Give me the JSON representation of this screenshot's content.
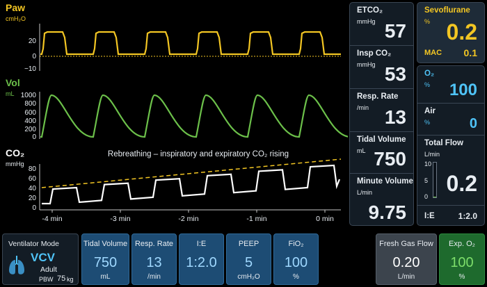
{
  "waveforms": {
    "paw": {
      "label": "Paw",
      "unit": "cmH₂O",
      "ticks": [
        "20",
        "0",
        "−10"
      ],
      "color": "#f3c623"
    },
    "vol": {
      "label": "Vol",
      "unit": "mL",
      "ticks": [
        "1000",
        "800",
        "600",
        "400",
        "200",
        "0"
      ],
      "color": "#6cc04a"
    },
    "co2": {
      "label": "CO₂",
      "unit": "mmHg",
      "ticks": [
        "80",
        "60",
        "40",
        "20",
        "0"
      ],
      "color": "#ffffff",
      "annotation": "Rebreathing – inspiratory and expiratory CO₂ rising"
    },
    "time_axis": [
      "-4 min",
      "-3 min",
      "-2 min",
      "-1 min",
      "0 min"
    ]
  },
  "measurements": {
    "etco2": {
      "label": "ETCO₂",
      "unit": "mmHg",
      "value": "57"
    },
    "insp_co2": {
      "label": "Insp CO₂",
      "unit": "mmHg",
      "value": "53"
    },
    "resp_rate": {
      "label": "Resp. Rate",
      "unit": "/min",
      "value": "13"
    },
    "tidal_volume": {
      "label": "Tidal Volume",
      "unit": "mL",
      "value": "750"
    },
    "minute_volume": {
      "label": "Minute Volume",
      "unit": "L/min",
      "value": "9.75"
    }
  },
  "gas": {
    "agent": {
      "label": "Sevoflurane",
      "unit": "%",
      "value": "0.2",
      "mac_label": "MAC",
      "mac_value": "0.1"
    },
    "o2": {
      "label": "O₂",
      "unit": "%",
      "value": "100"
    },
    "air": {
      "label": "Air",
      "unit": "%",
      "value": "0"
    },
    "total_flow": {
      "label": "Total Flow",
      "unit": "L/min",
      "value": "0.2",
      "bar_ticks": [
        "10",
        "5",
        "0"
      ],
      "bar_level": 0.02
    },
    "ie": {
      "label": "I:E",
      "value": "1:2.0"
    }
  },
  "ventilator": {
    "mode_label": "Ventilator Mode",
    "mode": "VCV",
    "patient": "Adult",
    "pbw_label": "PBW",
    "pbw_value": "75",
    "pbw_unit": "kg",
    "settings": [
      {
        "label": "Tidal Volume",
        "value": "750",
        "unit": "mL"
      },
      {
        "label": "Resp. Rate",
        "value": "13",
        "unit": "/min"
      },
      {
        "label": "I:E",
        "value": "1:2.0",
        "unit": ""
      },
      {
        "label": "PEEP",
        "value": "5",
        "unit": "cmH₂O"
      },
      {
        "label": "FiO₂",
        "value": "100",
        "unit": "%"
      }
    ]
  },
  "fresh_gas": {
    "label": "Fresh Gas Flow",
    "value": "0.20",
    "unit": "L/min"
  },
  "exp_o2": {
    "label": "Exp. O₂",
    "value": "100",
    "unit": "%"
  },
  "colors": {
    "pressure": "#f3c623",
    "volume": "#6cc04a",
    "co2": "#ffffff",
    "accent_blue": "#4fc3f7",
    "trend_dashed": "#f3c623"
  }
}
